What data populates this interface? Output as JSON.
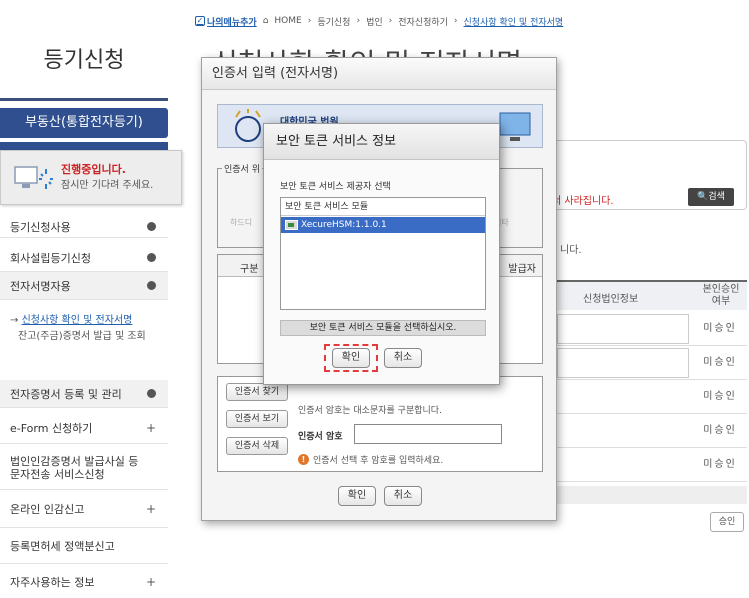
{
  "topbar": {
    "mymenu": "나의메뉴추가",
    "crumbs": [
      "HOME",
      "등기신청",
      "법인",
      "전자신청하기"
    ],
    "current": "신청사항 확인 및 전자서명"
  },
  "sidebar": {
    "title": "등기신청",
    "btn_realestate": "부동산(통합전자등기)",
    "items": [
      {
        "label": "등기신청사용"
      },
      {
        "label": "회사설립등기신청"
      },
      {
        "label": "전자서명자용"
      },
      {
        "label": "전자증명서 등록 및 관리"
      },
      {
        "label": "e-Form 신청하기"
      },
      {
        "label": "법인인감증명서 발급사실 등 문자전송 서비스신청"
      },
      {
        "label": "온라인 인감신고"
      },
      {
        "label": "등록면허세 정액분신고"
      },
      {
        "label": "자주사용하는 정보"
      }
    ],
    "sub_link": "신청사항 확인 및 전자서명",
    "sub_text": "잔고(주금)증명서 발급 및 조회"
  },
  "progress": {
    "title": "진행중입니다.",
    "text": "잠시만 기다려 주세요."
  },
  "page": {
    "title": "신청사항 확인 및 전자서명",
    "red_text": "서 사라집니다.",
    "search_label": "검색",
    "dot_text": "니다.",
    "col_corp": "신청법인정보",
    "col_approve": "본인승인여부",
    "status": [
      "미승인",
      "미승인",
      "미승인",
      "미승인",
      "미승인"
    ],
    "small_btn": "승인"
  },
  "cert": {
    "title": "인증서 입력 (전자서명)",
    "banner": "대한민국 법원",
    "legend": "인증서 위",
    "lbl_hdd": "하드디",
    "lbl_other": "기타",
    "col_type": "구분",
    "col_issuer": "발급자",
    "btn_find": "인증서 찾기",
    "btn_view": "인증서 보기",
    "btn_delete": "인증서 삭제",
    "hint": "인증서 암호는 대소문자를 구분합니다.",
    "pw_label": "인증서 암호",
    "warning": "인증서 선택 후 암호를 입력하세요.",
    "ok": "확인",
    "cancel": "취소"
  },
  "token": {
    "title": "보안 토큰 서비스 정보",
    "label": "보안 토큰 서비스 제공자 선택",
    "list_header": "보안 토큰 서비스 모듈",
    "items": [
      {
        "name": "XecureHSM:1.1.0.1"
      }
    ],
    "message": "보안 토큰 서비스 모듈을 선택하십시오.",
    "ok": "확인",
    "cancel": "취소"
  },
  "colors": {
    "accent": "#2f4f8f",
    "selection": "#3b6cc5",
    "warning": "#cc2222",
    "highlight": "#e23b3b"
  }
}
